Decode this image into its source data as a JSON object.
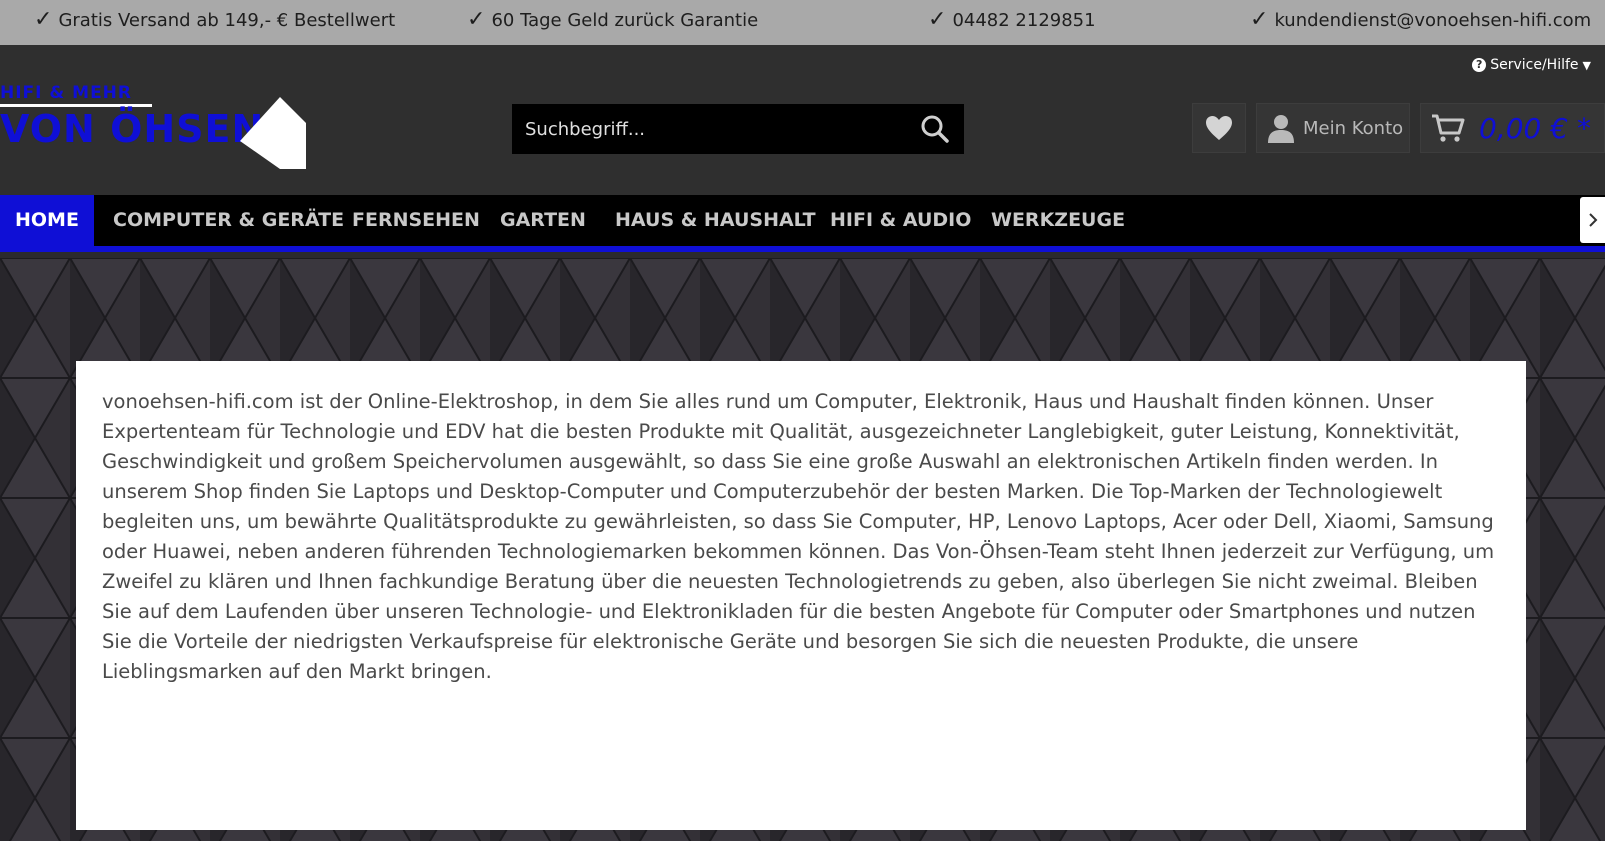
{
  "topbar": {
    "items": [
      "Gratis Versand ab 149,- € Bestellwert",
      "60 Tage Geld zurück Garantie",
      "04482 2129851",
      "kundendienst@vonoehsen-hifi.com"
    ],
    "check_icon": "checkmark-icon"
  },
  "header": {
    "service_label": "Service/Hilfe",
    "logo": {
      "small_text": "HIFI & MEHR",
      "big_text": "VON ÖHSEN"
    },
    "search": {
      "placeholder": "Suchbegriff..."
    },
    "account_label": "Mein Konto",
    "cart_amount": "0,00 € *"
  },
  "nav": {
    "items": [
      "HOME",
      "COMPUTER & GERÄTE",
      "FERNSEHEN",
      "GARTEN",
      "HAUS & HAUSHALT",
      "HIFI & AUDIO",
      "WERKZEUGE"
    ]
  },
  "content": {
    "text": "vonoehsen-hifi.com ist der Online-Elektroshop, in dem Sie alles rund um Computer, Elektronik, Haus und Haushalt finden können. Unser Expertenteam für Technologie und EDV hat die besten Produkte mit Qualität, ausgezeichneter Langlebigkeit, guter Leistung, Konnektivität, Geschwindigkeit und großem Speichervolumen ausgewählt, so dass Sie eine große Auswahl an elektronischen Artikeln finden werden. In unserem Shop finden Sie Laptops und Desktop-Computer und Computerzubehör der besten Marken. Die Top-Marken der Technologiewelt begleiten uns, um bewährte Qualitätsprodukte zu gewährleisten, so dass Sie Computer, HP, Lenovo Laptops, Acer oder Dell, Xiaomi, Samsung oder Huawei, neben anderen führenden Technologiemarken bekommen können. Das Von-Öhsen-Team steht Ihnen jederzeit zur Verfügung, um Zweifel zu klären und Ihnen fachkundige Beratung über die neuesten Technologietrends zu geben, also überlegen Sie nicht zweimal. Bleiben Sie auf dem Laufenden über unseren Technologie- und Elektronikladen für die besten Angebote für Computer oder Smartphones und nutzen Sie die Vorteile der niedrigsten Verkaufspreise für elektronische Geräte und besorgen Sie sich die neuesten Produkte, die unsere Lieblingsmarken auf den Markt bringen."
  },
  "colors": {
    "brand_blue": "#0f0fd6",
    "topbar_bg": "#a9a9a9",
    "header_bg": "#2f2f2f",
    "nav_bg": "#000000"
  }
}
